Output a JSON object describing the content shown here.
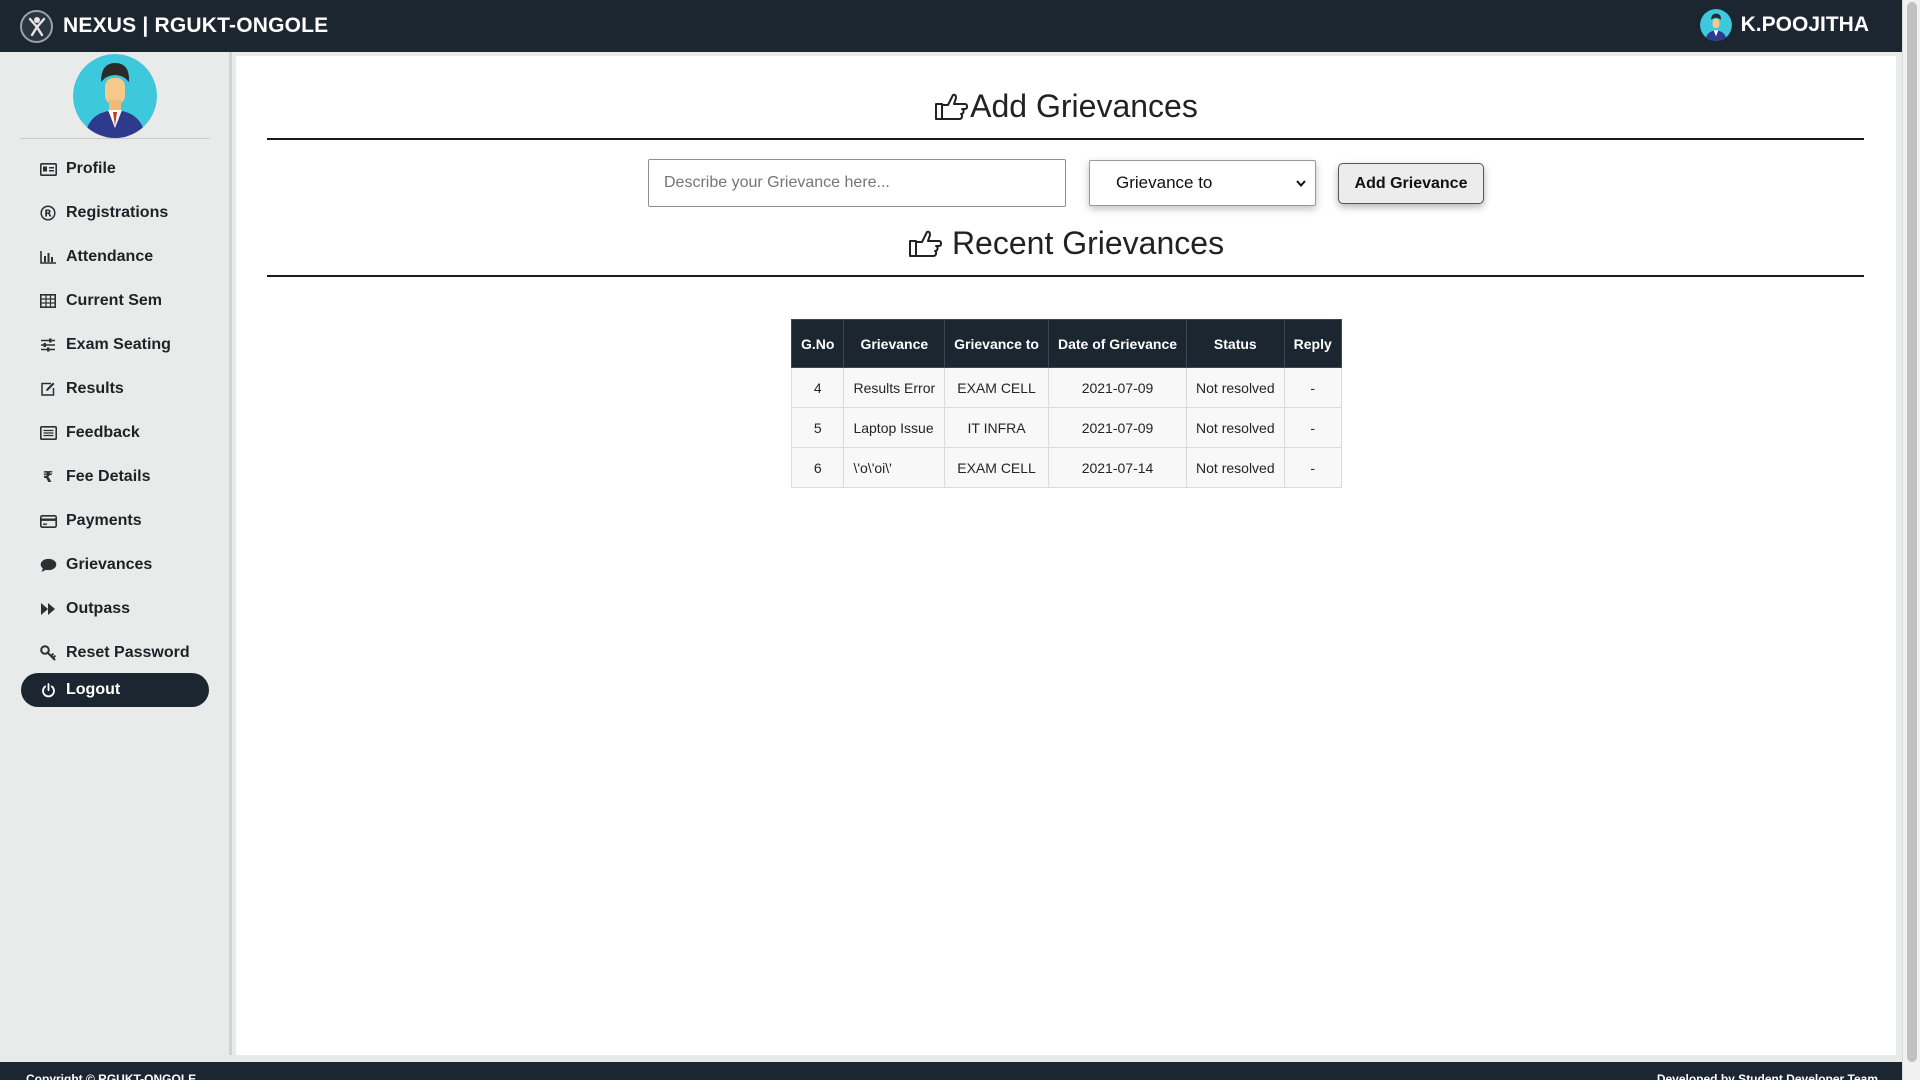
{
  "header": {
    "brand": "NEXUS | RGUKT-ONGOLE",
    "user_name": "K.POOJITHA",
    "background": "#1b2631"
  },
  "sidebar": {
    "items": [
      {
        "label": "Profile",
        "icon": "id-card-icon"
      },
      {
        "label": "Registrations",
        "icon": "registered-icon"
      },
      {
        "label": "Attendance",
        "icon": "bar-chart-icon"
      },
      {
        "label": "Current Sem",
        "icon": "table-icon"
      },
      {
        "label": "Exam Seating",
        "icon": "sliders-icon"
      },
      {
        "label": "Results",
        "icon": "edit-icon"
      },
      {
        "label": "Feedback",
        "icon": "list-alt-icon"
      },
      {
        "label": "Fee Details",
        "icon": "rupee-icon"
      },
      {
        "label": "Payments",
        "icon": "credit-card-icon"
      },
      {
        "label": "Grievances",
        "icon": "comment-icon"
      },
      {
        "label": "Outpass",
        "icon": "fast-forward-icon"
      },
      {
        "label": "Reset Password",
        "icon": "key-icon"
      }
    ],
    "logout_label": "Logout"
  },
  "main": {
    "add_title": "Add Grievances",
    "recent_title": "Recent Grievances",
    "input_placeholder": "Describe your Grievance here...",
    "select_value": "Grievance to",
    "add_button": "Add Grievance"
  },
  "table": {
    "headers": [
      "G.No",
      "Grievance",
      "Grievance to",
      "Date of Grievance",
      "Status",
      "Reply"
    ],
    "rows": [
      [
        "4",
        "Results Error",
        "EXAM CELL",
        "2021-07-09",
        "Not resolved",
        "-"
      ],
      [
        "5",
        "Laptop Issue",
        "IT INFRA",
        "2021-07-09",
        "Not resolved",
        "-"
      ],
      [
        "6",
        "\\'o\\'oi\\'",
        "EXAM CELL",
        "2021-07-14",
        "Not resolved",
        "-"
      ]
    ]
  },
  "footer": {
    "left": "Copyright © RGUKT-ONGOLE",
    "right": "Developed by Student Developer Team"
  }
}
